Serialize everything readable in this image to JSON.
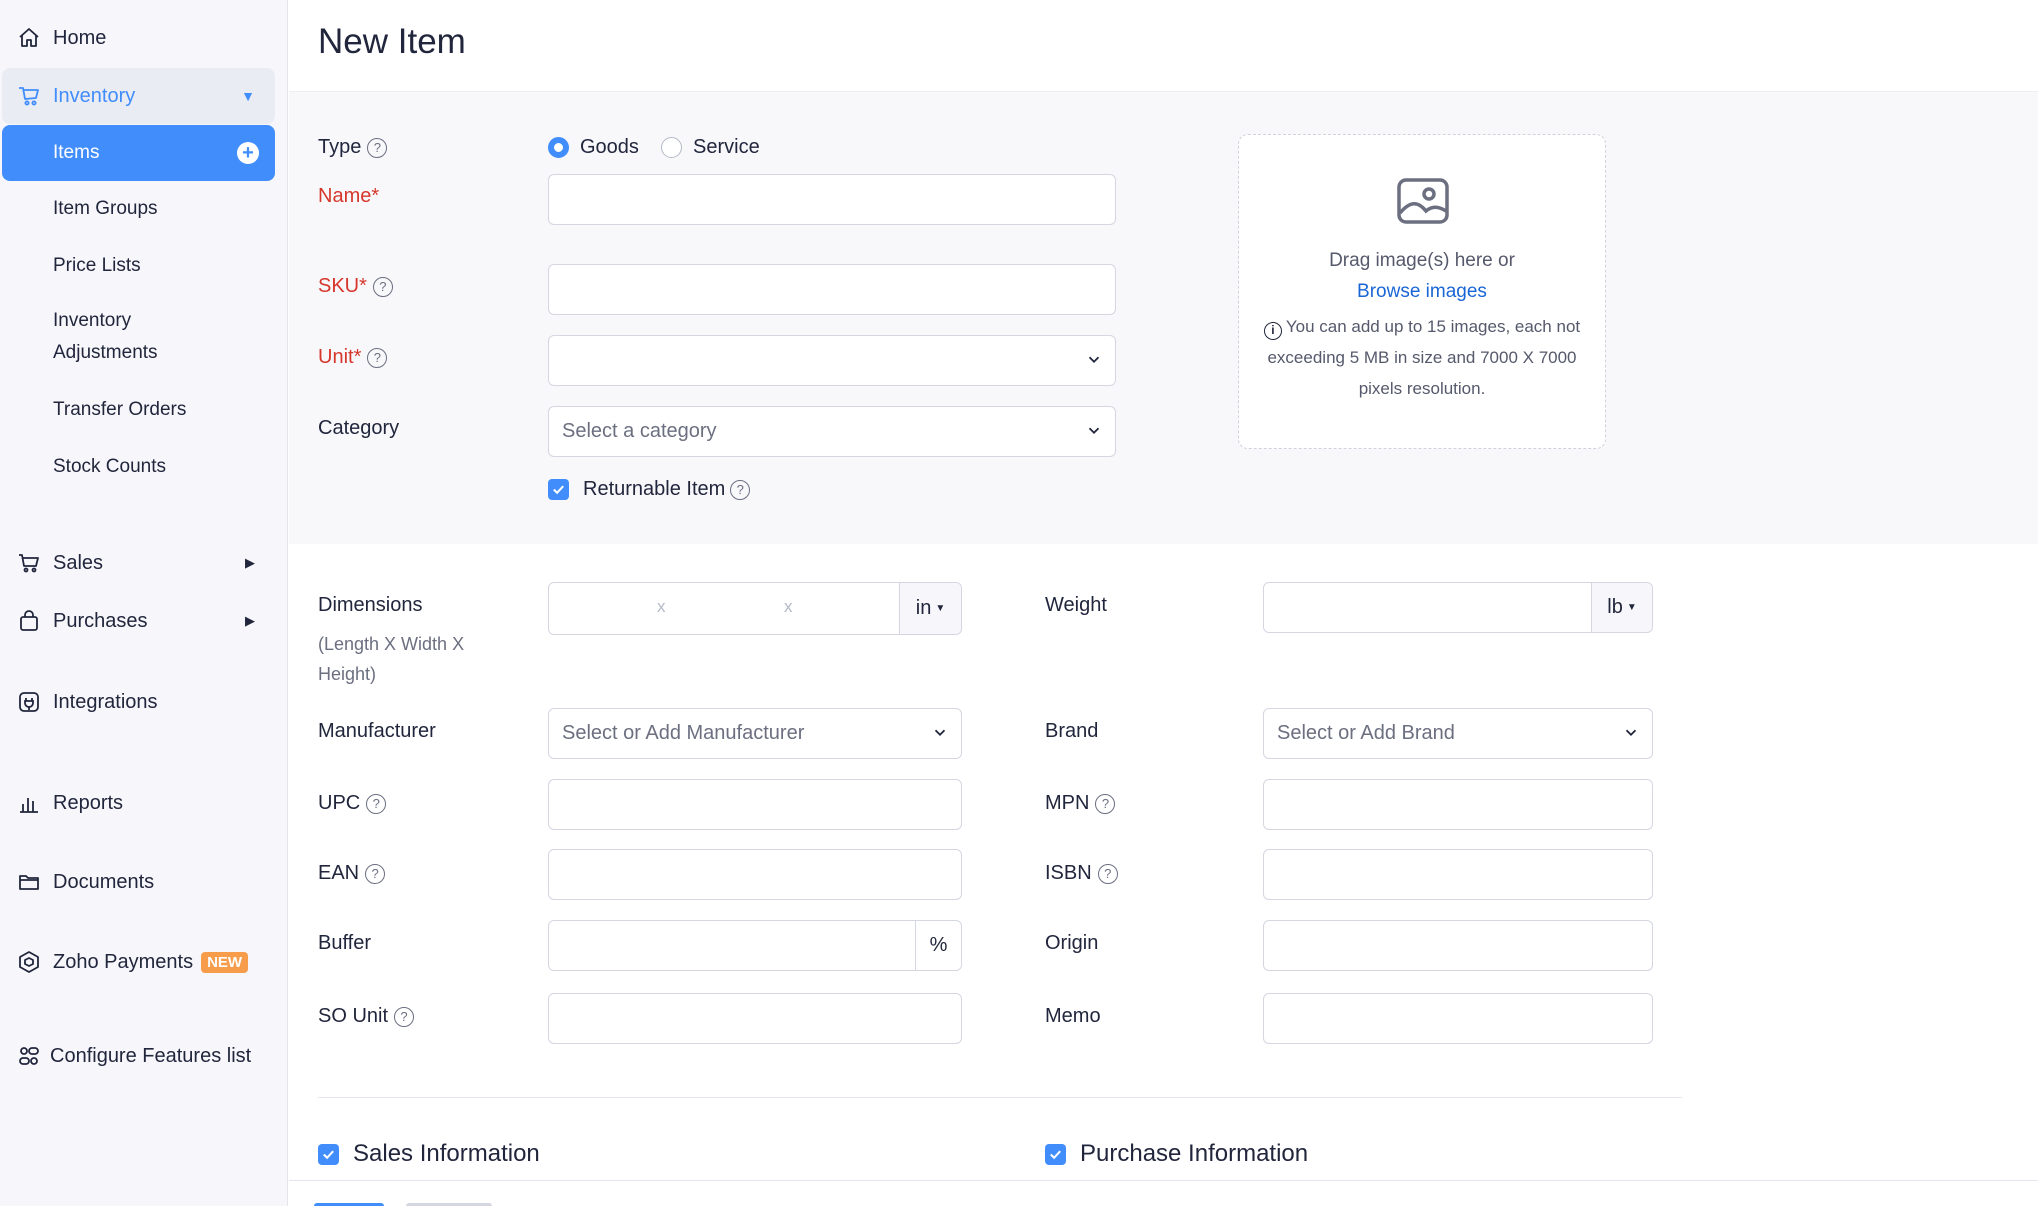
{
  "sidebar": {
    "home": "Home",
    "inventory": "Inventory",
    "inventory_sub": [
      "Items",
      "Item Groups",
      "Price Lists",
      "Inventory Adjustments",
      "Transfer Orders",
      "Stock Counts"
    ],
    "sales": "Sales",
    "purchases": "Purchases",
    "integrations": "Integrations",
    "reports": "Reports",
    "documents": "Documents",
    "zoho_payments": "Zoho Payments",
    "new_badge": "NEW",
    "configure": "Configure Features list"
  },
  "header": {
    "title": "New Item"
  },
  "form": {
    "type_label": "Type",
    "type_options": [
      "Goods",
      "Service"
    ],
    "type_selected": "Goods",
    "name_label": "Name*",
    "sku_label": "SKU*",
    "unit_label": "Unit*",
    "category_label": "Category",
    "category_placeholder": "Select a category",
    "returnable_label": "Returnable Item",
    "dimensions_label": "Dimensions",
    "dimensions_hint": "(Length X Width X Height)",
    "dimensions_sep": "x",
    "dimensions_unit": "in",
    "weight_label": "Weight",
    "weight_unit": "lb",
    "manufacturer_label": "Manufacturer",
    "manufacturer_placeholder": "Select or Add Manufacturer",
    "brand_label": "Brand",
    "brand_placeholder": "Select or Add Brand",
    "upc_label": "UPC",
    "mpn_label": "MPN",
    "ean_label": "EAN",
    "isbn_label": "ISBN",
    "buffer_label": "Buffer",
    "buffer_unit": "%",
    "origin_label": "Origin",
    "so_unit_label": "SO Unit",
    "memo_label": "Memo"
  },
  "dropzone": {
    "line1": "Drag image(s) here or",
    "link": "Browse images",
    "note": "You can add up to 15 images, each not exceeding 5 MB in size and 7000 X 7000 pixels resolution."
  },
  "sections": {
    "sales_info": "Sales Information",
    "purchase_info": "Purchase Information"
  },
  "colors": {
    "accent": "#408dfb",
    "required": "#d6372b",
    "badge": "#f79c4b",
    "link": "#1a66d6"
  }
}
